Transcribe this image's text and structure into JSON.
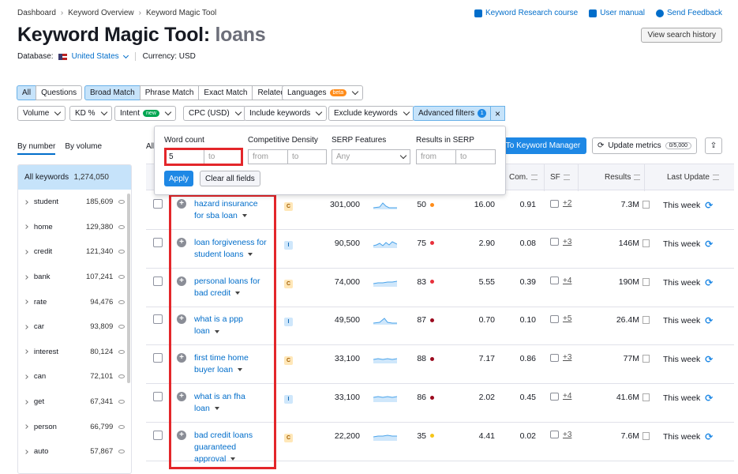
{
  "breadcrumb": [
    "Dashboard",
    "Keyword Overview",
    "Keyword Magic Tool"
  ],
  "toplinks": [
    "Keyword Research course",
    "User manual",
    "Send Feedback"
  ],
  "title": "Keyword Magic Tool:",
  "query": "loans",
  "database_label": "Database:",
  "database_value": "United States",
  "currency": "Currency: USD",
  "view_history": "View search history",
  "match_tabs": [
    "All",
    "Questions",
    "Broad Match",
    "Phrase Match",
    "Exact Match",
    "Related"
  ],
  "languages": "Languages",
  "beta": "beta",
  "filters": {
    "volume": "Volume",
    "kd": "KD %",
    "intent": "Intent",
    "new": "new",
    "cpc": "CPC (USD)",
    "include": "Include keywords",
    "exclude": "Exclude keywords",
    "advanced": "Advanced filters",
    "advanced_count": "1",
    "close": "×"
  },
  "popover": {
    "word_count": "Word count",
    "word_from": "5",
    "to": "to",
    "from": "from",
    "competitive_density": "Competitive Density",
    "serp_features": "SERP Features",
    "any": "Any",
    "results_in_serp": "Results in SERP",
    "apply": "Apply",
    "clear": "Clear all fields"
  },
  "sidebar": {
    "tab_number": "By number",
    "tab_volume": "By volume",
    "all_label": "All keywords",
    "all_count": "1,274,050",
    "items": [
      {
        "kw": "student",
        "n": "185,609"
      },
      {
        "kw": "home",
        "n": "129,380"
      },
      {
        "kw": "credit",
        "n": "121,340"
      },
      {
        "kw": "bank",
        "n": "107,241"
      },
      {
        "kw": "rate",
        "n": "94,476"
      },
      {
        "kw": "car",
        "n": "93,809"
      },
      {
        "kw": "interest",
        "n": "80,124"
      },
      {
        "kw": "can",
        "n": "72,101"
      },
      {
        "kw": "get",
        "n": "67,341"
      },
      {
        "kw": "person",
        "n": "66,799"
      },
      {
        "kw": "auto",
        "n": "57,867"
      }
    ]
  },
  "toolbar": {
    "all": "All",
    "to_manager": "To Keyword Manager",
    "update": "Update metrics",
    "update_count": "0/5,000"
  },
  "headers": {
    "com": "Com.",
    "sf": "SF",
    "results": "Results",
    "last_update": "Last Update"
  },
  "colors": {
    "accent": "#1e88e5",
    "highlight": "#e3262a"
  },
  "rows": [
    {
      "kw1": "hazard insurance",
      "kw2": "for sba loan",
      "kw3": "",
      "intent": "C",
      "vol": "301,000",
      "kd": "50",
      "kdc": "#ff8c1a",
      "cpc": "16.00",
      "com": "0.91",
      "sf": "+2",
      "res": "7.3M",
      "lu": "This week"
    },
    {
      "kw1": "loan forgiveness for",
      "kw2": "student loans",
      "kw3": "",
      "intent": "I",
      "vol": "90,500",
      "kd": "75",
      "kdc": "#e8303b",
      "cpc": "2.90",
      "com": "0.08",
      "sf": "+3",
      "res": "146M",
      "lu": "This week"
    },
    {
      "kw1": "personal loans for",
      "kw2": "bad credit",
      "kw3": "",
      "intent": "C",
      "vol": "74,000",
      "kd": "83",
      "kdc": "#e8303b",
      "cpc": "5.55",
      "com": "0.39",
      "sf": "+4",
      "res": "190M",
      "lu": "This week"
    },
    {
      "kw1": "what is a ppp",
      "kw2": "loan",
      "kw3": "",
      "intent": "I",
      "vol": "49,500",
      "kd": "87",
      "kdc": "#9b0a1e",
      "cpc": "0.70",
      "com": "0.10",
      "sf": "+5",
      "res": "26.4M",
      "lu": "This week"
    },
    {
      "kw1": "first time home",
      "kw2": "buyer loan",
      "kw3": "",
      "intent": "C",
      "vol": "33,100",
      "kd": "88",
      "kdc": "#9b0a1e",
      "cpc": "7.17",
      "com": "0.86",
      "sf": "+3",
      "res": "77M",
      "lu": "This week"
    },
    {
      "kw1": "what is an fha",
      "kw2": "loan",
      "kw3": "",
      "intent": "I",
      "vol": "33,100",
      "kd": "86",
      "kdc": "#9b0a1e",
      "cpc": "2.02",
      "com": "0.45",
      "sf": "+4",
      "res": "41.6M",
      "lu": "This week"
    },
    {
      "kw1": "bad credit loans",
      "kw2": "guaranteed",
      "kw3": "approval",
      "intent": "C",
      "vol": "22,200",
      "kd": "35",
      "kdc": "#f5c518",
      "cpc": "4.41",
      "com": "0.02",
      "sf": "+3",
      "res": "7.6M",
      "lu": "This week"
    }
  ]
}
